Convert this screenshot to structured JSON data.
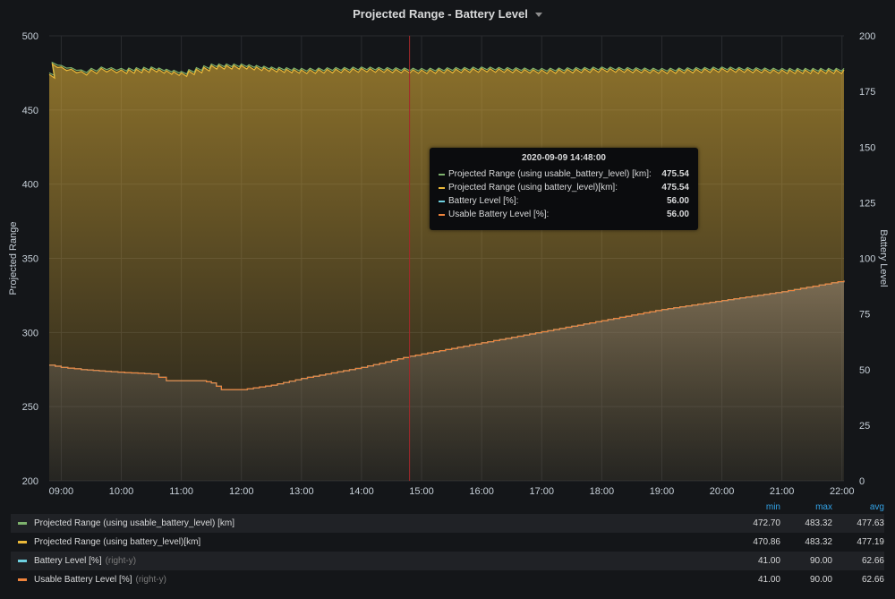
{
  "panel": {
    "title": "Projected Range - Battery Level"
  },
  "colors": {
    "usable_range": "#7eb26d",
    "range": "#eab839",
    "battery": "#6ed0e0",
    "usable_battery": "#ef843c",
    "grid": "#2a2c30",
    "cursor": "#a3282b"
  },
  "chart_data": {
    "type": "line",
    "title": "Projected Range - Battery Level",
    "x_ticks": [
      "09:00",
      "10:00",
      "11:00",
      "12:00",
      "13:00",
      "14:00",
      "15:00",
      "16:00",
      "17:00",
      "18:00",
      "19:00",
      "20:00",
      "21:00",
      "22:00"
    ],
    "x_range": [
      "08:48",
      "22:02"
    ],
    "y_left": {
      "label": "Projected Range",
      "range": [
        200,
        500
      ],
      "ticks": [
        "500",
        "450",
        "400",
        "350",
        "300",
        "250",
        "200"
      ]
    },
    "y_right": {
      "label": "Battery Level",
      "range": [
        0,
        200
      ],
      "ticks": [
        "200",
        "175",
        "150",
        "125",
        "100",
        "75",
        "50",
        "25",
        "0"
      ]
    },
    "grid": true,
    "series": [
      {
        "name": "Projected Range (using usable_battery_level) [km]",
        "axis": "left",
        "color": "#7eb26d",
        "points": [
          [
            "08:48",
            475
          ],
          [
            "08:51",
            482
          ],
          [
            "09:00",
            480
          ],
          [
            "09:20",
            477
          ],
          [
            "09:40",
            479
          ],
          [
            "10:00",
            478
          ],
          [
            "10:30",
            479
          ],
          [
            "11:00",
            476
          ],
          [
            "11:30",
            481
          ],
          [
            "12:00",
            481
          ],
          [
            "12:30",
            479
          ],
          [
            "13:00",
            478
          ],
          [
            "14:00",
            479
          ],
          [
            "15:00",
            478
          ],
          [
            "16:00",
            479
          ],
          [
            "17:00",
            478
          ],
          [
            "18:00",
            479
          ],
          [
            "19:00",
            478
          ],
          [
            "20:00",
            479
          ],
          [
            "21:00",
            478
          ],
          [
            "22:02",
            478
          ]
        ],
        "stats": {
          "min": "472.70",
          "max": "483.32",
          "avg": "477.63"
        }
      },
      {
        "name": "Projected Range (using battery_level)[km]",
        "axis": "left",
        "color": "#eab839",
        "points": [
          [
            "08:48",
            474
          ],
          [
            "08:51",
            481
          ],
          [
            "09:00",
            479
          ],
          [
            "09:20",
            476
          ],
          [
            "09:40",
            478
          ],
          [
            "10:00",
            477
          ],
          [
            "10:30",
            478
          ],
          [
            "11:00",
            475
          ],
          [
            "11:30",
            480
          ],
          [
            "12:00",
            480
          ],
          [
            "12:30",
            478
          ],
          [
            "13:00",
            477
          ],
          [
            "14:00",
            478
          ],
          [
            "15:00",
            477
          ],
          [
            "16:00",
            478
          ],
          [
            "17:00",
            477
          ],
          [
            "18:00",
            478
          ],
          [
            "19:00",
            477
          ],
          [
            "20:00",
            478
          ],
          [
            "21:00",
            477
          ],
          [
            "22:02",
            477
          ]
        ],
        "stats": {
          "min": "470.86",
          "max": "483.32",
          "avg": "477.19"
        }
      },
      {
        "name": "Battery Level [%]",
        "axis": "right",
        "color": "#6ed0e0",
        "points": [
          [
            "08:48",
            52
          ],
          [
            "09:00",
            51
          ],
          [
            "09:20",
            50
          ],
          [
            "09:50",
            49
          ],
          [
            "10:30",
            48
          ],
          [
            "10:45",
            45
          ],
          [
            "11:20",
            45
          ],
          [
            "11:30",
            44
          ],
          [
            "11:40",
            41
          ],
          [
            "12:00",
            41
          ],
          [
            "12:30",
            43
          ],
          [
            "13:00",
            46
          ],
          [
            "14:00",
            51
          ],
          [
            "14:48",
            56
          ],
          [
            "15:00",
            57
          ],
          [
            "16:00",
            62
          ],
          [
            "17:00",
            67
          ],
          [
            "18:00",
            72
          ],
          [
            "19:00",
            77
          ],
          [
            "20:00",
            81
          ],
          [
            "21:00",
            85
          ],
          [
            "22:02",
            90
          ]
        ],
        "stats": {
          "min": "41.00",
          "max": "90.00",
          "avg": "62.66"
        }
      },
      {
        "name": "Usable Battery Level [%]",
        "axis": "right",
        "color": "#ef843c",
        "points": [
          [
            "08:48",
            52
          ],
          [
            "09:00",
            51
          ],
          [
            "09:20",
            50
          ],
          [
            "09:50",
            49
          ],
          [
            "10:30",
            48
          ],
          [
            "10:45",
            45
          ],
          [
            "11:20",
            45
          ],
          [
            "11:30",
            44
          ],
          [
            "11:40",
            41
          ],
          [
            "12:00",
            41
          ],
          [
            "12:30",
            43
          ],
          [
            "13:00",
            46
          ],
          [
            "14:00",
            51
          ],
          [
            "14:48",
            56
          ],
          [
            "15:00",
            57
          ],
          [
            "16:00",
            62
          ],
          [
            "17:00",
            67
          ],
          [
            "18:00",
            72
          ],
          [
            "19:00",
            77
          ],
          [
            "20:00",
            81
          ],
          [
            "21:00",
            85
          ],
          [
            "22:02",
            90
          ]
        ],
        "stats": {
          "min": "41.00",
          "max": "90.00",
          "avg": "62.66"
        }
      }
    ],
    "hover_time": "14:48"
  },
  "tooltip": {
    "time": "2020-09-09 14:48:00",
    "rows": [
      {
        "label": "Projected Range (using usable_battery_level) [km]:",
        "value": "475.54"
      },
      {
        "label": "Projected Range (using battery_level)[km]:",
        "value": "475.54"
      },
      {
        "label": "Battery Level [%]:",
        "value": "56.00"
      },
      {
        "label": "Usable Battery Level [%]:",
        "value": "56.00"
      }
    ]
  },
  "legend": {
    "headers": {
      "min": "min",
      "max": "max",
      "avg": "avg"
    },
    "axis_tag": "(right-y)",
    "rows": [
      {
        "name": "Projected Range (using usable_battery_level) [km]",
        "right_y": false,
        "min": "472.70",
        "max": "483.32",
        "avg": "477.63"
      },
      {
        "name": "Projected Range (using battery_level)[km]",
        "right_y": false,
        "min": "470.86",
        "max": "483.32",
        "avg": "477.19"
      },
      {
        "name": "Battery Level [%]",
        "right_y": true,
        "min": "41.00",
        "max": "90.00",
        "avg": "62.66"
      },
      {
        "name": "Usable Battery Level [%]",
        "right_y": true,
        "min": "41.00",
        "max": "90.00",
        "avg": "62.66"
      }
    ]
  }
}
